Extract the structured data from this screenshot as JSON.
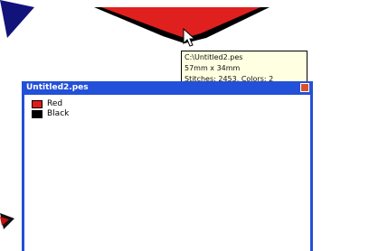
{
  "tooltip": {
    "path": "C:\\Untitled2.pes",
    "dimensions": "57mm x 34mm",
    "stitches": "Stitches: 2453, Colors: 2"
  },
  "window": {
    "title": "Untitled2.pes",
    "colors": [
      {
        "label": "Red",
        "hex": "#e11b1b"
      },
      {
        "label": "Black",
        "hex": "#000000"
      }
    ]
  },
  "accent": {
    "titlebar": "#2350d8",
    "shape_red": "#e0201e",
    "shape_navy": "#11127a"
  }
}
